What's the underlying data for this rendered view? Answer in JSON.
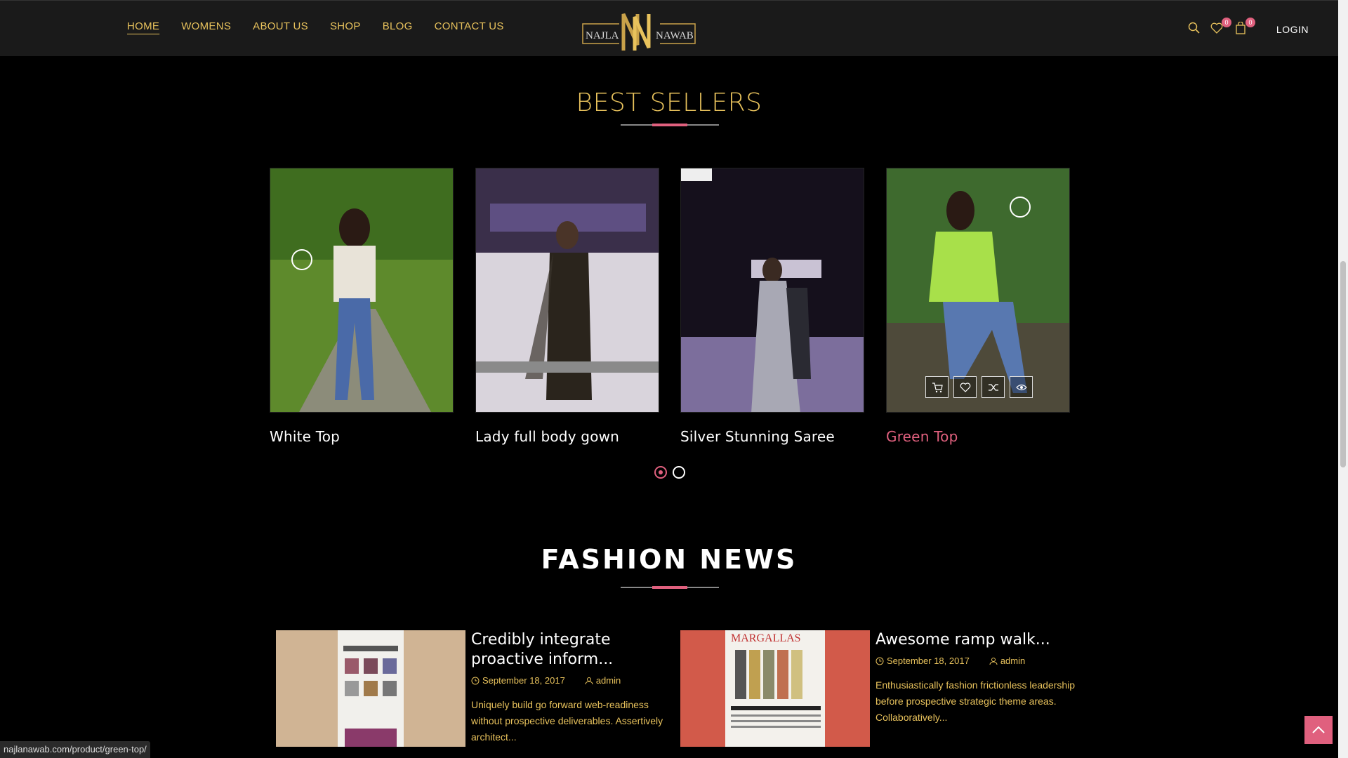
{
  "nav": {
    "items": [
      "HOME",
      "WOMENS",
      "ABOUT US",
      "SHOP",
      "BLOG",
      "CONTACT US"
    ],
    "active": "HOME"
  },
  "logo": {
    "left": "NAJLA",
    "right": "NAWAB"
  },
  "header": {
    "wishlist_count": "0",
    "cart_count": "0",
    "login_label": "LOGIN"
  },
  "best_sellers": {
    "title": "BEST SELLERS",
    "products": [
      {
        "name": "White Top"
      },
      {
        "name": "Lady full body gown"
      },
      {
        "name": "Silver Stunning Saree"
      },
      {
        "name": "Green Top"
      }
    ]
  },
  "fashion_news": {
    "title": "FASHION NEWS",
    "posts": [
      {
        "title": "Credibly integrate proactive inform...",
        "date": "September 18, 2017",
        "author": "admin",
        "excerpt": "Uniquely build go forward web-readiness without prospective deliverables. Assertively architect..."
      },
      {
        "title": "Awesome ramp walk...",
        "date": "September 18, 2017",
        "author": "admin",
        "excerpt": "Enthusiastically fashion frictionless leadership before prospective strategic theme areas. Collaboratively..."
      }
    ]
  },
  "status_url": "najlanawab.com/product/green-top/",
  "colors": {
    "gold": "#e8c25c",
    "pink": "#e0607e",
    "header_bg": "#1a1a1a"
  }
}
